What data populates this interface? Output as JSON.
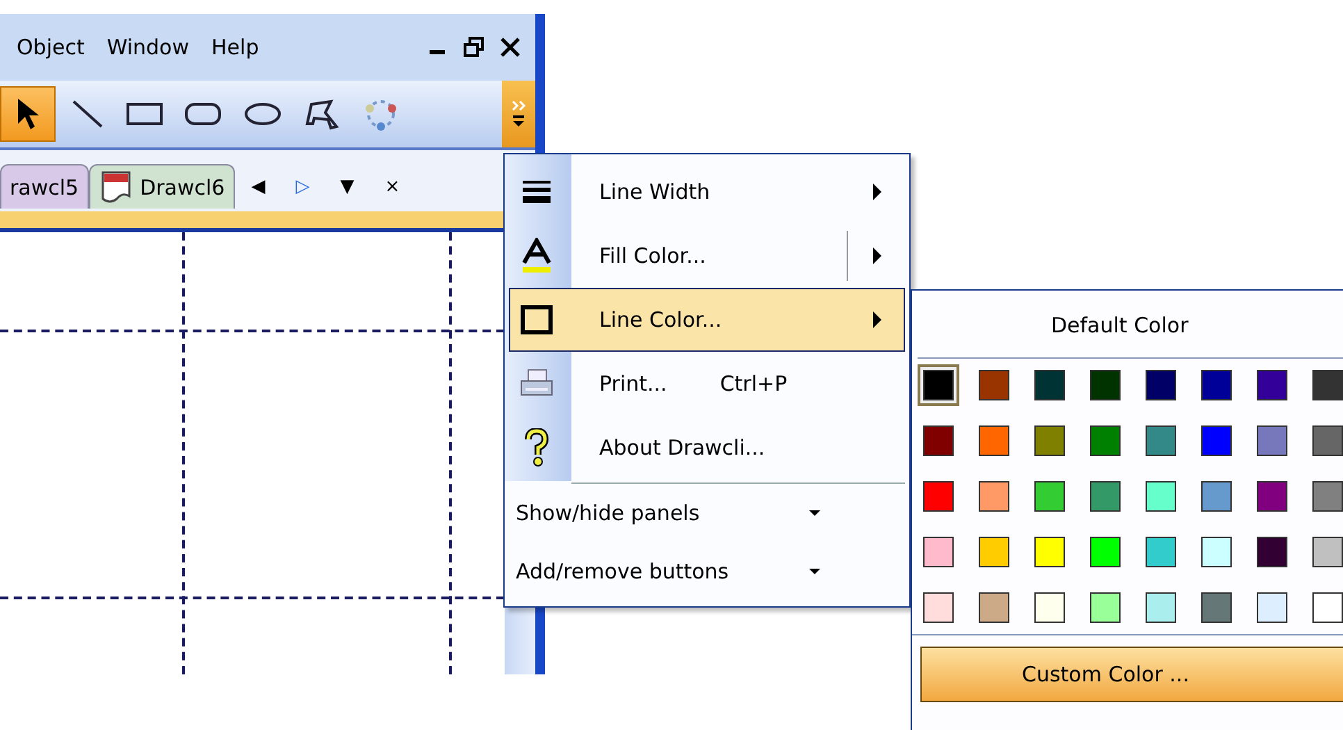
{
  "menu_bar": {
    "items": [
      "Object",
      "Window",
      "Help"
    ]
  },
  "toolbar": {
    "tools": [
      {
        "kind": "pointer",
        "selected": true
      },
      {
        "kind": "line",
        "selected": false
      },
      {
        "kind": "rectangle",
        "selected": false
      },
      {
        "kind": "rounded-rectangle",
        "selected": false
      },
      {
        "kind": "ellipse",
        "selected": false
      },
      {
        "kind": "polygon",
        "selected": false
      },
      {
        "kind": "multicolor",
        "selected": false
      }
    ]
  },
  "tabs": [
    {
      "label": "rawcl5",
      "selected": false,
      "icon": false
    },
    {
      "label": "Drawcl6",
      "selected": true,
      "icon": true
    }
  ],
  "tab_nav": [
    "◀",
    "▷",
    "▼",
    "×"
  ],
  "context_menu": {
    "items": [
      {
        "label": "Line Width",
        "kind": "submenu",
        "selected": false
      },
      {
        "label": "Fill Color...",
        "kind": "split",
        "selected": false
      },
      {
        "label": "Line Color...",
        "kind": "submenu",
        "selected": true
      },
      {
        "label": "Print...",
        "shortcut": "Ctrl+P",
        "kind": "plain",
        "selected": false
      },
      {
        "label": "About Drawcli...",
        "kind": "plain",
        "selected": false
      }
    ],
    "footer_items": [
      {
        "label": "Show/hide panels"
      },
      {
        "label": "Add/remove buttons"
      }
    ]
  },
  "color_picker": {
    "default_label": "Default Color",
    "custom_label": "Custom Color ...",
    "swatches": [
      {
        "color": "#000000",
        "selected": true
      },
      {
        "color": "#993300",
        "selected": false
      },
      {
        "color": "#003333",
        "selected": false
      },
      {
        "color": "#003300",
        "selected": false
      },
      {
        "color": "#000066",
        "selected": false
      },
      {
        "color": "#000099",
        "selected": false
      },
      {
        "color": "#330099",
        "selected": false
      },
      {
        "color": "#333333",
        "selected": false
      },
      {
        "color": "#800000",
        "selected": false
      },
      {
        "color": "#ff6600",
        "selected": false
      },
      {
        "color": "#808000",
        "selected": false
      },
      {
        "color": "#008000",
        "selected": false
      },
      {
        "color": "#338888",
        "selected": false
      },
      {
        "color": "#0000ff",
        "selected": false
      },
      {
        "color": "#7777bb",
        "selected": false
      },
      {
        "color": "#666666",
        "selected": false
      },
      {
        "color": "#ff0000",
        "selected": false
      },
      {
        "color": "#ff9966",
        "selected": false
      },
      {
        "color": "#33cc33",
        "selected": false
      },
      {
        "color": "#339966",
        "selected": false
      },
      {
        "color": "#66ffcc",
        "selected": false
      },
      {
        "color": "#6699cc",
        "selected": false
      },
      {
        "color": "#800080",
        "selected": false
      },
      {
        "color": "#808080",
        "selected": false
      },
      {
        "color": "#ffbbcc",
        "selected": false
      },
      {
        "color": "#ffcc00",
        "selected": false
      },
      {
        "color": "#ffff00",
        "selected": false
      },
      {
        "color": "#00ff00",
        "selected": false
      },
      {
        "color": "#33cccc",
        "selected": false
      },
      {
        "color": "#ccffff",
        "selected": false
      },
      {
        "color": "#330033",
        "selected": false
      },
      {
        "color": "#c0c0c0",
        "selected": false
      },
      {
        "color": "#ffdddd",
        "selected": false
      },
      {
        "color": "#ccaa88",
        "selected": false
      },
      {
        "color": "#ffffee",
        "selected": false
      },
      {
        "color": "#99ff99",
        "selected": false
      },
      {
        "color": "#aaeeee",
        "selected": false
      },
      {
        "color": "#667777",
        "selected": false
      },
      {
        "color": "#ddeeff",
        "selected": false
      },
      {
        "color": "#ffffff",
        "selected": false
      }
    ]
  }
}
